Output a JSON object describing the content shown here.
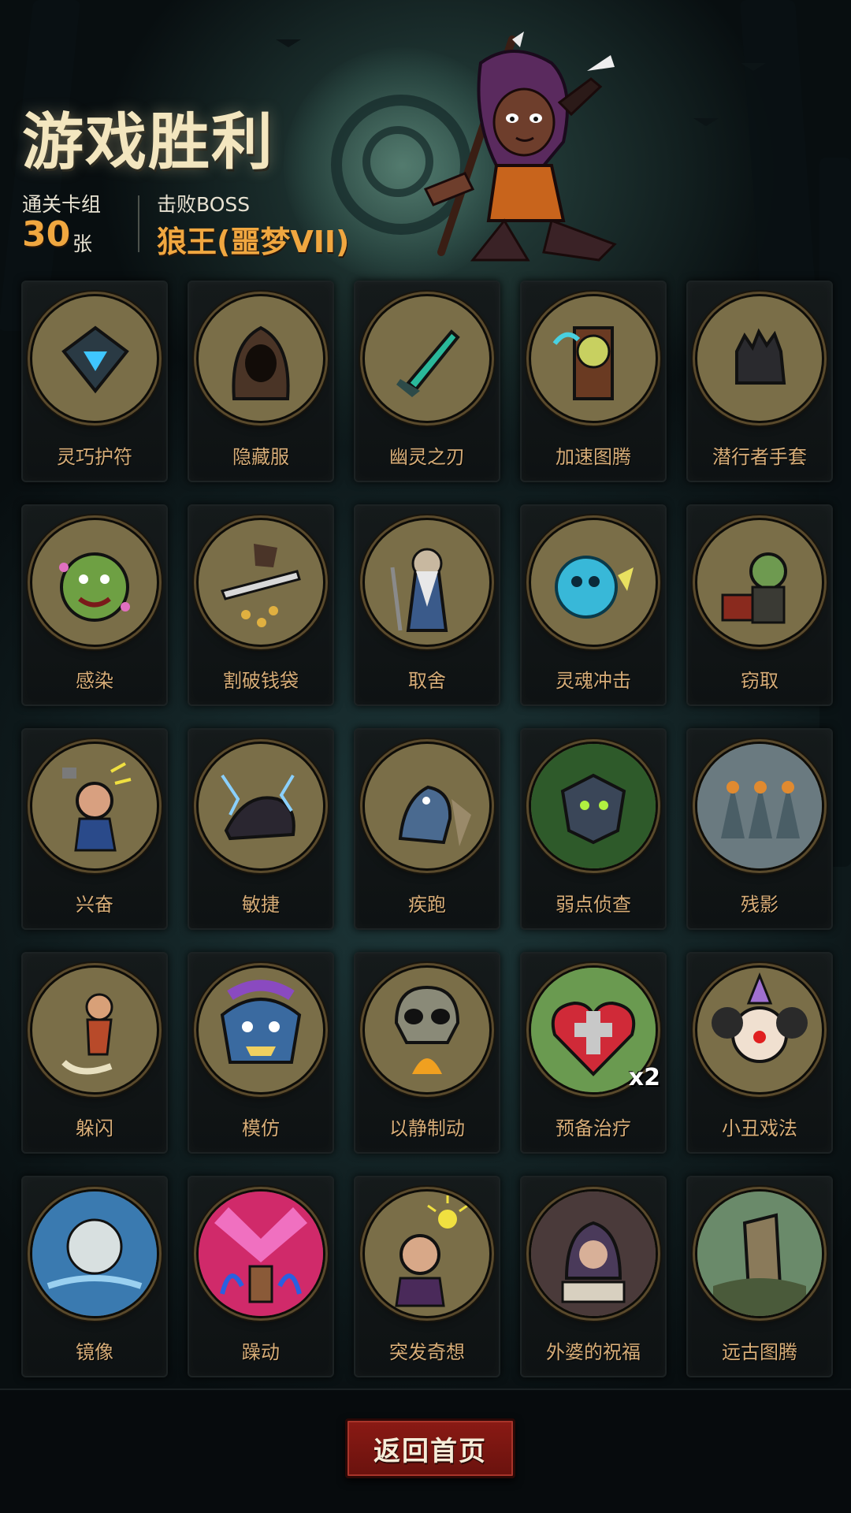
{
  "header": {
    "title": "游戏胜利",
    "deck_label": "通关卡组",
    "deck_count": "30",
    "deck_unit": "张",
    "boss_label": "击败BOSS",
    "boss_name": "狼王(噩梦VII)"
  },
  "cards": [
    {
      "label": "灵巧护符",
      "icon": "amulet-icon"
    },
    {
      "label": "隐藏服",
      "icon": "hood-cloak-icon"
    },
    {
      "label": "幽灵之刃",
      "icon": "ghost-blade-icon"
    },
    {
      "label": "加速图腾",
      "icon": "clock-totem-icon"
    },
    {
      "label": "潜行者手套",
      "icon": "glove-icon"
    },
    {
      "label": "感染",
      "icon": "infected-monster-icon"
    },
    {
      "label": "割破钱袋",
      "icon": "cut-purse-icon"
    },
    {
      "label": "取舍",
      "icon": "wizard-icon"
    },
    {
      "label": "灵魂冲击",
      "icon": "soul-blast-icon"
    },
    {
      "label": "窃取",
      "icon": "goblin-thief-icon"
    },
    {
      "label": "兴奋",
      "icon": "excited-dwarf-icon"
    },
    {
      "label": "敏捷",
      "icon": "panther-icon"
    },
    {
      "label": "疾跑",
      "icon": "running-wolf-icon"
    },
    {
      "label": "弱点侦查",
      "icon": "wolf-face-icon"
    },
    {
      "label": "残影",
      "icon": "afterimage-icon"
    },
    {
      "label": "躲闪",
      "icon": "dodge-girl-icon"
    },
    {
      "label": "模仿",
      "icon": "goblin-face-icon"
    },
    {
      "label": "以静制动",
      "icon": "skull-flame-icon"
    },
    {
      "label": "预备治疗",
      "icon": "heart-cross-icon",
      "badge": "x2"
    },
    {
      "label": "小丑戏法",
      "icon": "clown-icon"
    },
    {
      "label": "镜像",
      "icon": "mirror-moon-icon"
    },
    {
      "label": "躁动",
      "icon": "frenzy-icon"
    },
    {
      "label": "突发奇想",
      "icon": "idea-scholar-icon"
    },
    {
      "label": "外婆的祝福",
      "icon": "grandma-icon"
    },
    {
      "label": "远古图腾",
      "icon": "ancient-totem-icon"
    }
  ],
  "footer": {
    "home_button_label": "返回首页"
  },
  "colors": {
    "accent_orange": "#f0a740",
    "card_label": "#d7ad78",
    "button_red": "#8a1a14",
    "title_cream": "#f3e6bf"
  }
}
